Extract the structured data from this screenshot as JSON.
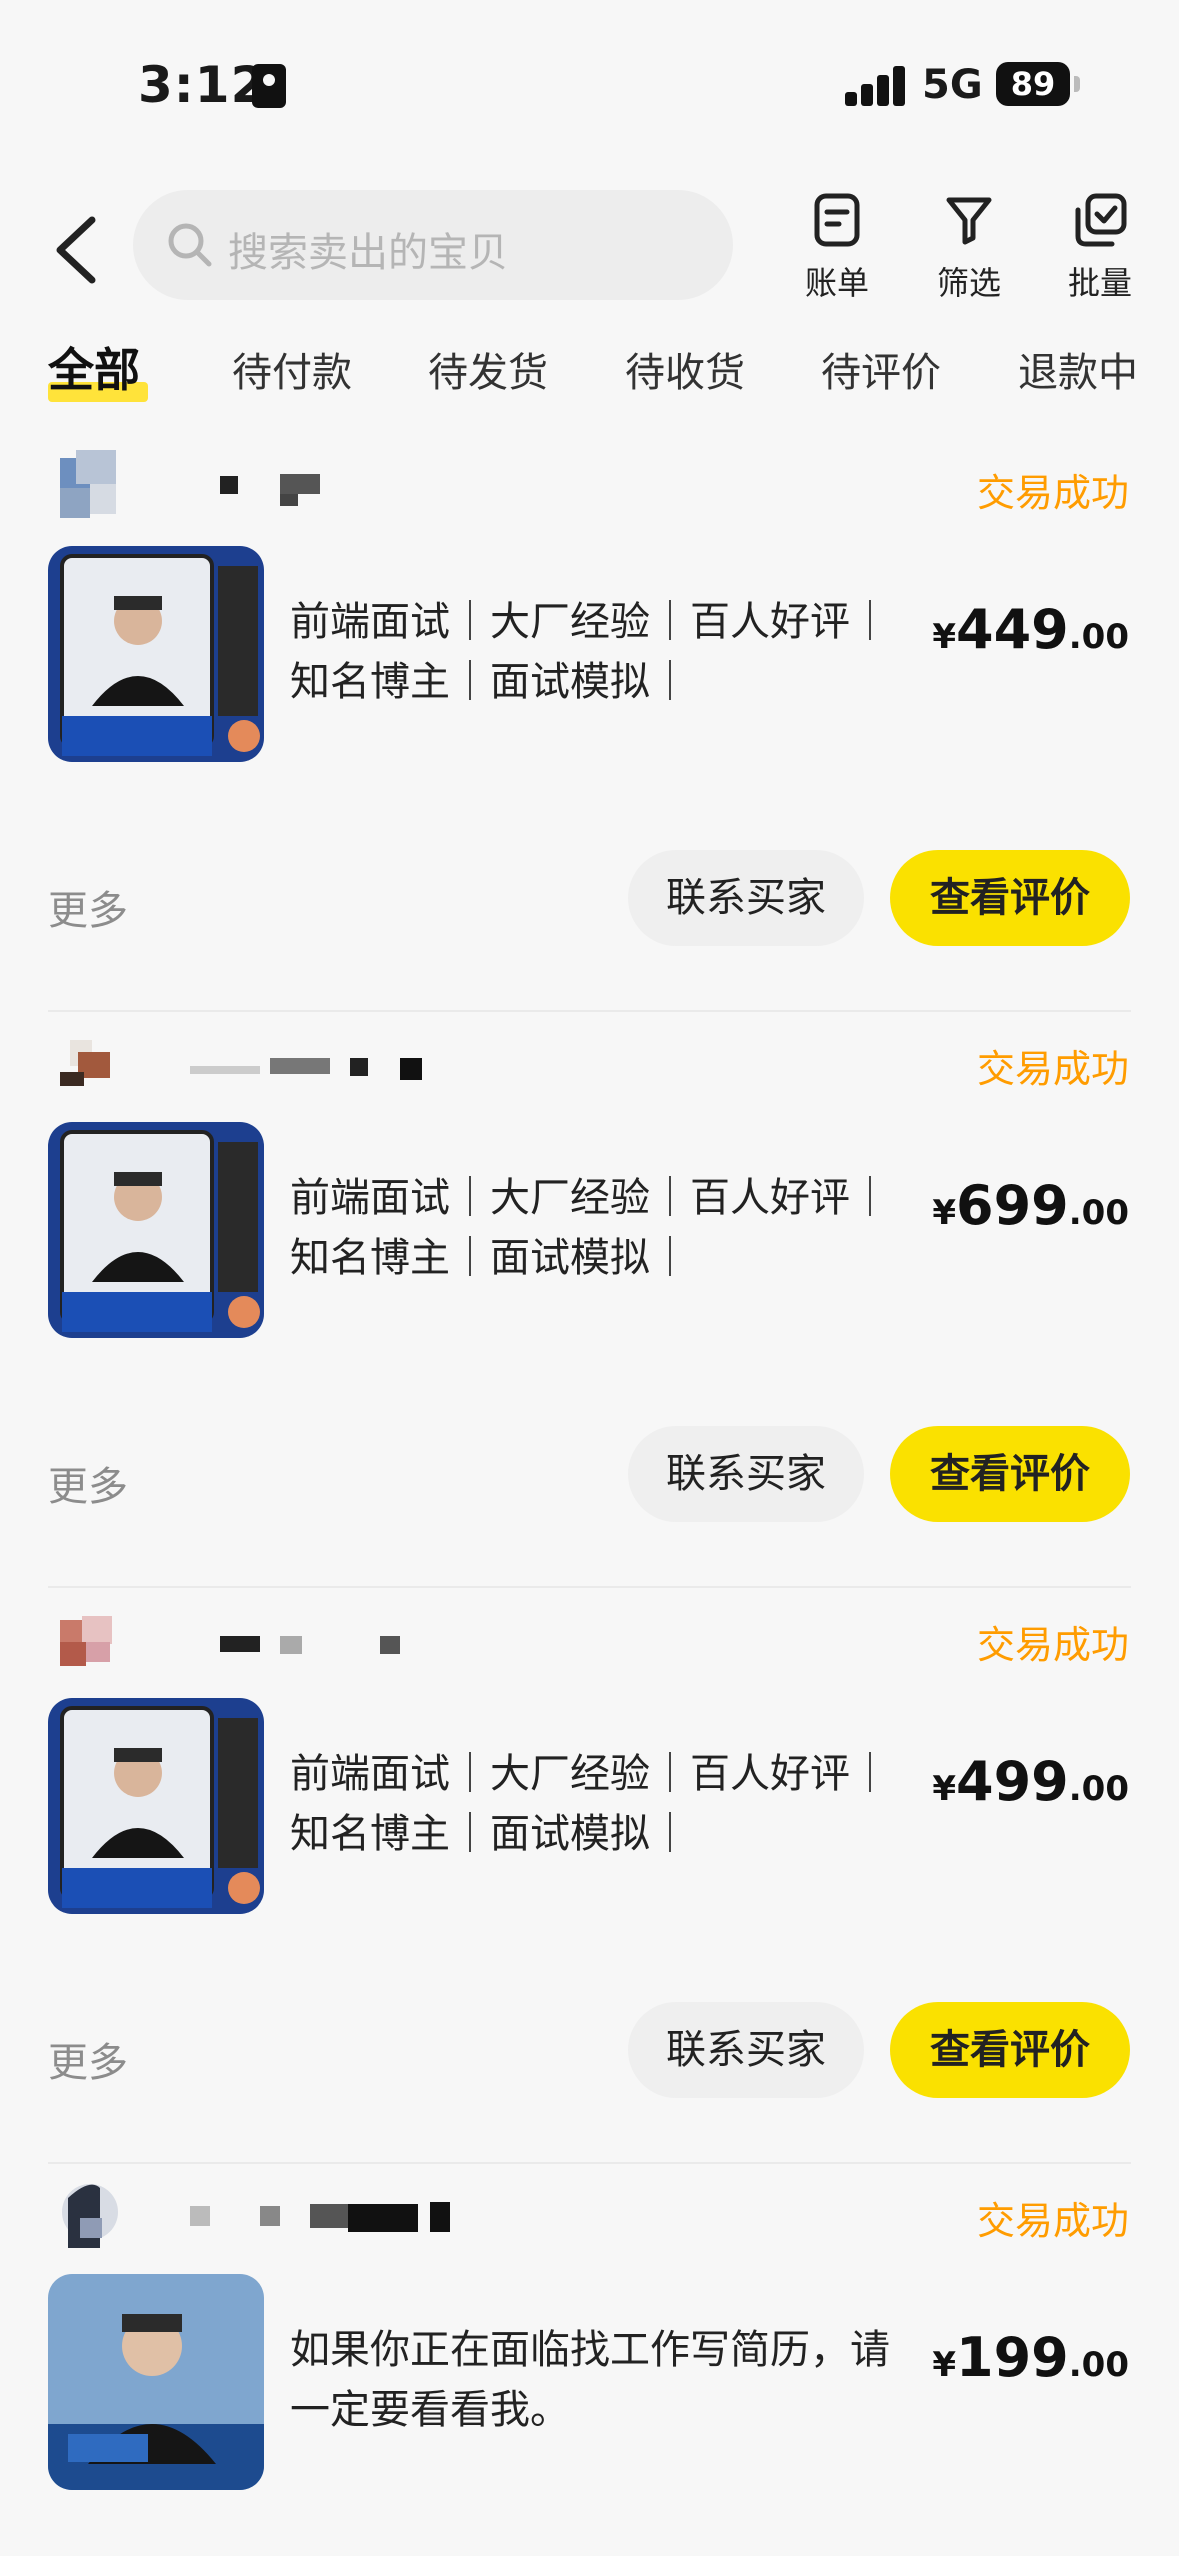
{
  "status_bar": {
    "time": "3:12",
    "network": "5G",
    "battery": "89"
  },
  "nav": {
    "search_placeholder": "搜索卖出的宝贝",
    "tools": [
      {
        "label": "账单",
        "icon": "bill-icon"
      },
      {
        "label": "筛选",
        "icon": "filter-icon"
      },
      {
        "label": "批量",
        "icon": "batch-icon"
      }
    ]
  },
  "tabs": [
    "全部",
    "待付款",
    "待发货",
    "待收货",
    "待评价",
    "退款中"
  ],
  "active_tab": "全部",
  "accent_color": "#fae100",
  "status_color": "#ff9c00",
  "orders": [
    {
      "status": "交易成功",
      "title": "前端面试｜大厂经验｜百人好评｜知名博主｜面试模拟｜",
      "price_symbol": "¥",
      "price_int": "449",
      "price_dec": ".00",
      "more": "更多",
      "contact_label": "联系买家",
      "review_label": "查看评价"
    },
    {
      "status": "交易成功",
      "title": "前端面试｜大厂经验｜百人好评｜知名博主｜面试模拟｜",
      "price_symbol": "¥",
      "price_int": "699",
      "price_dec": ".00",
      "more": "更多",
      "contact_label": "联系买家",
      "review_label": "查看评价"
    },
    {
      "status": "交易成功",
      "title": "前端面试｜大厂经验｜百人好评｜知名博主｜面试模拟｜",
      "price_symbol": "¥",
      "price_int": "499",
      "price_dec": ".00",
      "more": "更多",
      "contact_label": "联系买家",
      "review_label": "查看评价"
    },
    {
      "status": "交易成功",
      "title": "如果你正在面临找工作写简历，请一定要看看我。",
      "price_symbol": "¥",
      "price_int": "199",
      "price_dec": ".00"
    }
  ]
}
